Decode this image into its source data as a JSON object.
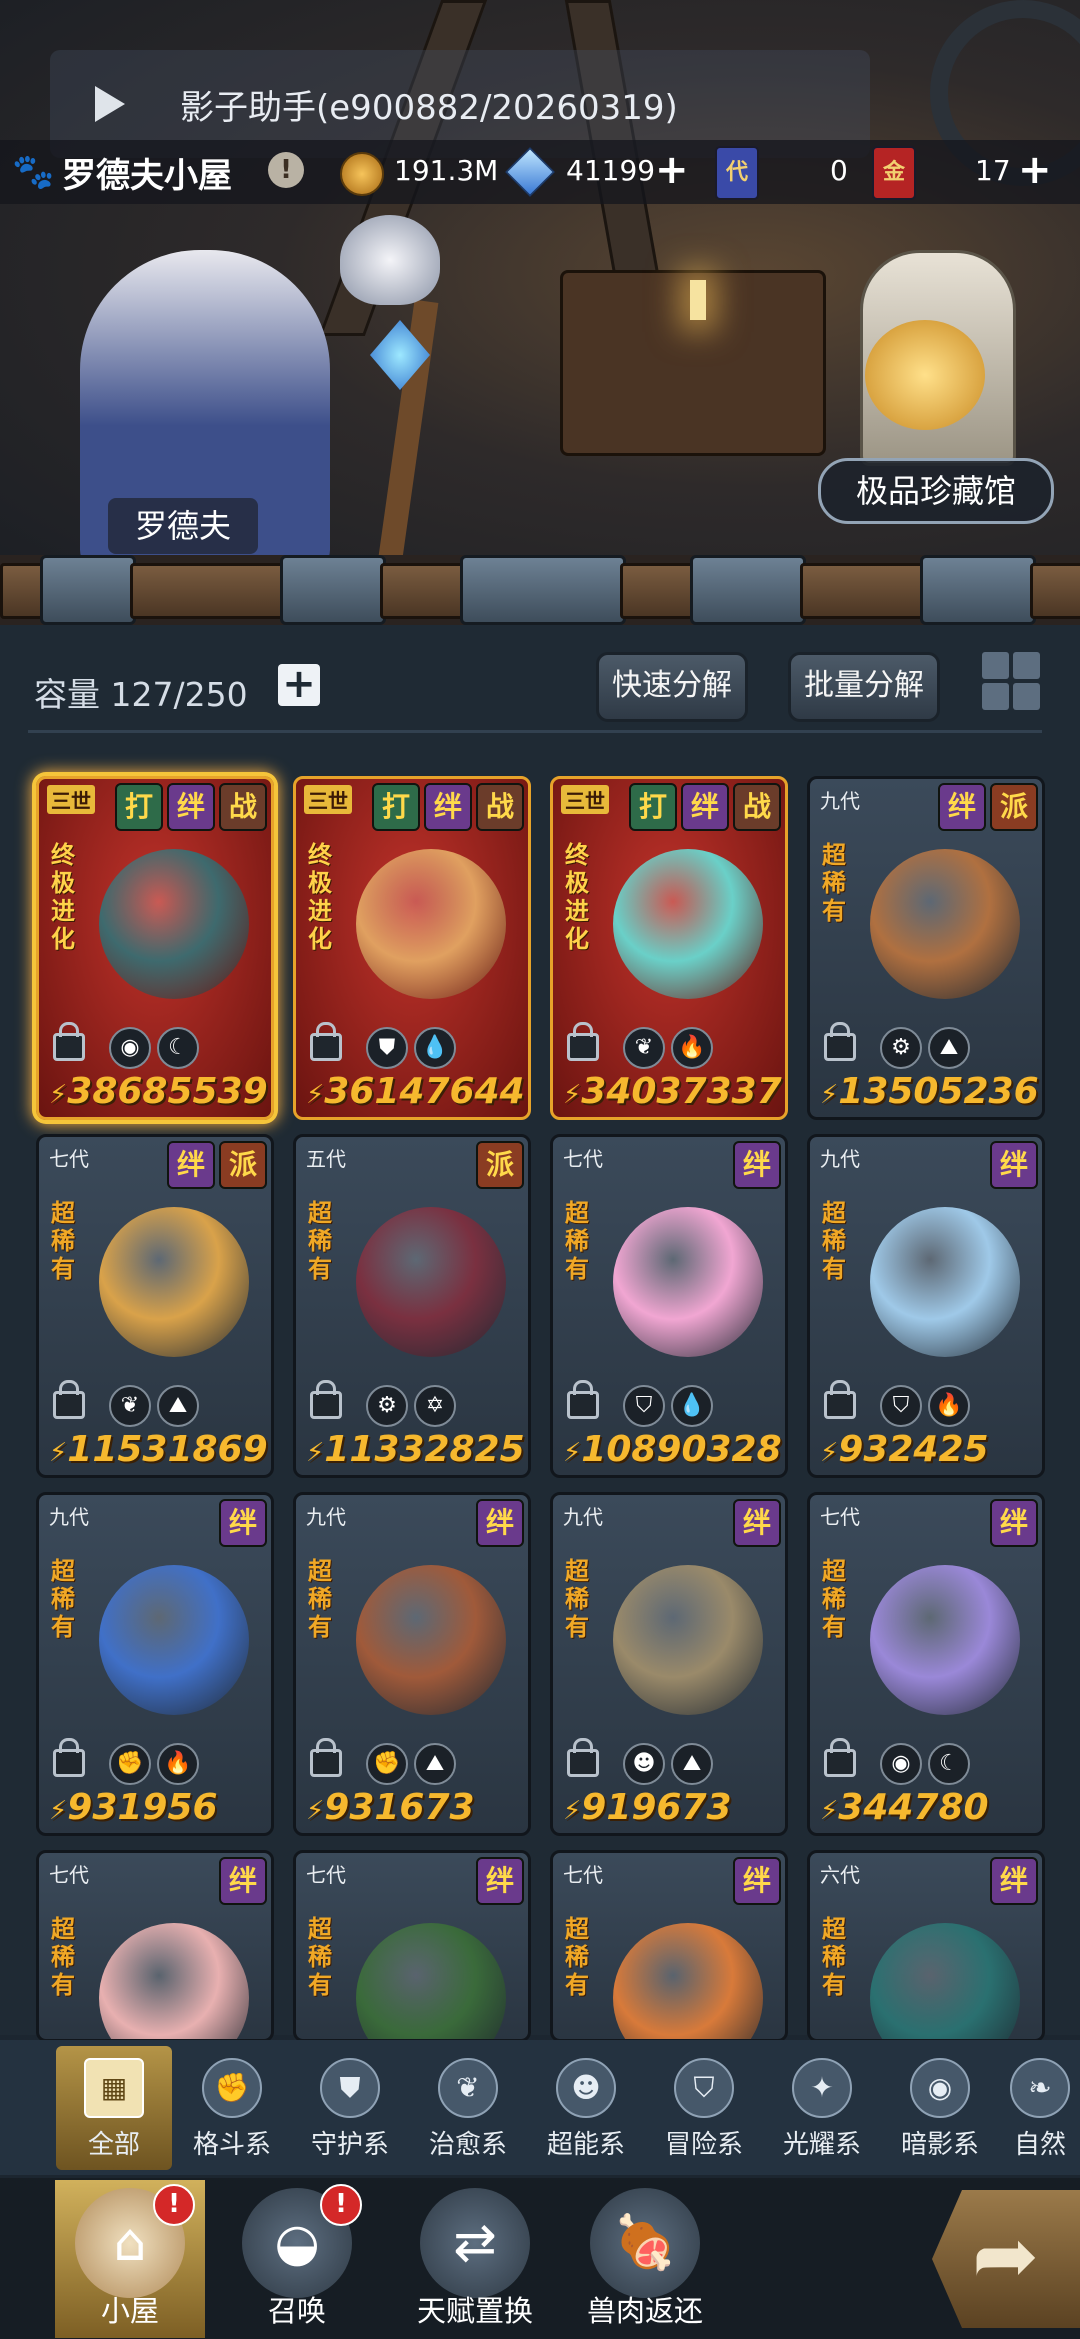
{
  "helper": {
    "title": "影子助手(e900882/20260319)"
  },
  "header": {
    "house_title": "罗德夫小屋",
    "coins": "191.3M",
    "crystals": "41199",
    "ticket_dai_label": "代",
    "ticket_dai": "0",
    "ticket_jin_label": "金",
    "ticket_jin": "17"
  },
  "scene": {
    "npc_name": "罗德夫",
    "gallery_label": "极品珍藏馆"
  },
  "inventory": {
    "capacity_label": "容量",
    "capacity": "127/250",
    "quick_decompose": "快速分解",
    "batch_decompose": "批量分解"
  },
  "cards": [
    {
      "gen": "三世",
      "rare": "终极进化",
      "badges": [
        "打",
        "绊",
        "战"
      ],
      "attrs": [
        "◉",
        "☾"
      ],
      "power": "38685539",
      "style": "red",
      "color": "#3e6a6e",
      "selected": true
    },
    {
      "gen": "三世",
      "rare": "终极进化",
      "badges": [
        "打",
        "绊",
        "战"
      ],
      "attrs": [
        "⛊",
        "💧"
      ],
      "power": "36147644",
      "style": "red",
      "color": "#e0a060",
      "selected": false
    },
    {
      "gen": "三世",
      "rare": "终极进化",
      "badges": [
        "打",
        "绊",
        "战"
      ],
      "attrs": [
        "❦",
        "🔥"
      ],
      "power": "34037337",
      "style": "red",
      "color": "#6ad0c8",
      "selected": false
    },
    {
      "gen": "九代",
      "rare": "超稀有",
      "badges": [
        "绊",
        "派"
      ],
      "attrs": [
        "⚙",
        "⛰"
      ],
      "power": "13505236",
      "style": "blue",
      "color": "#b07040"
    },
    {
      "gen": "七代",
      "rare": "超稀有",
      "badges": [
        "绊",
        "派"
      ],
      "attrs": [
        "❦",
        "⛰"
      ],
      "power": "11531869",
      "style": "blue",
      "color": "#d9a24a"
    },
    {
      "gen": "五代",
      "rare": "超稀有",
      "badges": [
        "派"
      ],
      "attrs": [
        "⚙",
        "✡"
      ],
      "power": "11332825",
      "style": "blue",
      "color": "#7a3040"
    },
    {
      "gen": "七代",
      "rare": "超稀有",
      "badges": [
        "绊"
      ],
      "attrs": [
        "⛉",
        "💧"
      ],
      "power": "10890328",
      "style": "blue",
      "color": "#f1a6d2"
    },
    {
      "gen": "九代",
      "rare": "超稀有",
      "badges": [
        "绊"
      ],
      "attrs": [
        "⛉",
        "🔥"
      ],
      "power": "932425",
      "style": "blue",
      "color": "#9fc9e8"
    },
    {
      "gen": "九代",
      "rare": "超稀有",
      "badges": [
        "绊"
      ],
      "attrs": [
        "✊",
        "🔥"
      ],
      "power": "931956",
      "style": "blue",
      "color": "#4070c8"
    },
    {
      "gen": "九代",
      "rare": "超稀有",
      "badges": [
        "绊"
      ],
      "attrs": [
        "✊",
        "⛰"
      ],
      "power": "931673",
      "style": "blue",
      "color": "#a05a3a"
    },
    {
      "gen": "九代",
      "rare": "超稀有",
      "badges": [
        "绊"
      ],
      "attrs": [
        "☻",
        "⛰"
      ],
      "power": "919673",
      "style": "blue",
      "color": "#9a8a6a"
    },
    {
      "gen": "七代",
      "rare": "超稀有",
      "badges": [
        "绊"
      ],
      "attrs": [
        "◉",
        "☾"
      ],
      "power": "344780",
      "style": "blue",
      "color": "#9a88d8"
    },
    {
      "gen": "七代",
      "rare": "超稀有",
      "badges": [
        "绊"
      ],
      "attrs": [],
      "power": "",
      "style": "blue",
      "color": "#e8b0b0"
    },
    {
      "gen": "七代",
      "rare": "超稀有",
      "badges": [
        "绊"
      ],
      "attrs": [],
      "power": "",
      "style": "blue",
      "color": "#3a6a3a"
    },
    {
      "gen": "七代",
      "rare": "超稀有",
      "badges": [
        "绊"
      ],
      "attrs": [],
      "power": "",
      "style": "blue",
      "color": "#d87a3a"
    },
    {
      "gen": "六代",
      "rare": "超稀有",
      "badges": [
        "绊"
      ],
      "attrs": [],
      "power": "",
      "style": "blue",
      "color": "#2a7070"
    }
  ],
  "categories": [
    {
      "label": "全部",
      "icon": "▦",
      "name": "all",
      "active": true
    },
    {
      "label": "格斗系",
      "icon": "✊",
      "name": "fighting"
    },
    {
      "label": "守护系",
      "icon": "⛊",
      "name": "guardian"
    },
    {
      "label": "治愈系",
      "icon": "❦",
      "name": "healing"
    },
    {
      "label": "超能系",
      "icon": "☻",
      "name": "psychic"
    },
    {
      "label": "冒险系",
      "icon": "⛉",
      "name": "adventure"
    },
    {
      "label": "光耀系",
      "icon": "✦",
      "name": "light"
    },
    {
      "label": "暗影系",
      "icon": "◉",
      "name": "shadow"
    },
    {
      "label": "自然",
      "icon": "❧",
      "name": "nature"
    }
  ],
  "nav": [
    {
      "label": "小屋",
      "icon": "⌂",
      "name": "house",
      "active": true,
      "alert": true
    },
    {
      "label": "召唤",
      "icon": "◒",
      "name": "summon",
      "alert": true
    },
    {
      "label": "天赋置换",
      "icon": "⇄",
      "name": "talent-swap"
    },
    {
      "label": "兽肉返还",
      "icon": "🍖",
      "name": "meat-return"
    }
  ],
  "colors": {
    "gold": "#f6b82e",
    "panel": "#1f2a34",
    "red_card": "#c0322a"
  }
}
